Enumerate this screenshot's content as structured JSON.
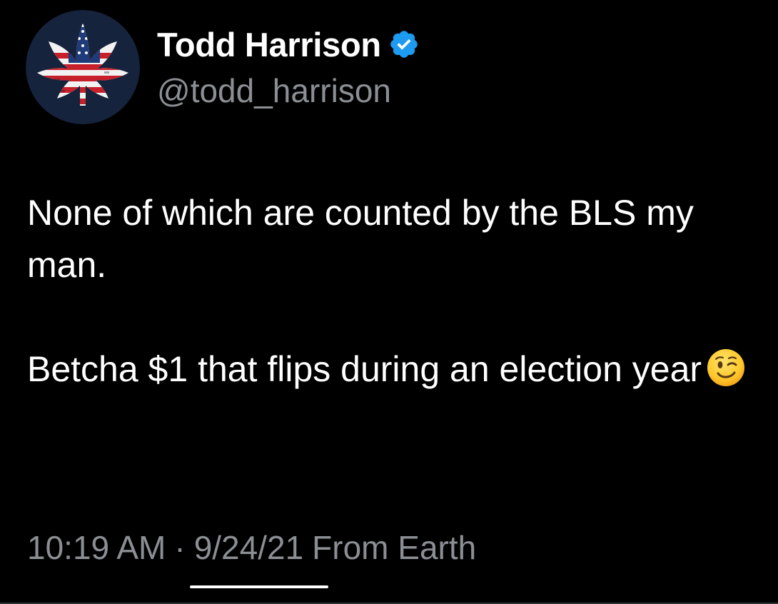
{
  "author": {
    "display_name": "Todd Harrison",
    "handle": "@todd_harrison",
    "avatar_icon": "usa-flag-cannabis-leaf-avatar",
    "verified_icon": "verified-badge-icon",
    "verified_color": "#1d9bf0"
  },
  "tweet": {
    "paragraphs": [
      "None of which are counted by the BLS my man.",
      "Betcha $1 that flips during an election year"
    ],
    "emoji_icon": "winking-face-emoji"
  },
  "meta": {
    "time": "10:19 AM",
    "separator": "·",
    "date": "9/24/21",
    "source": "From Earth"
  },
  "colors": {
    "background": "#000000",
    "text_primary": "#ffffff",
    "text_secondary": "#8b8f94",
    "accent": "#1d9bf0"
  }
}
